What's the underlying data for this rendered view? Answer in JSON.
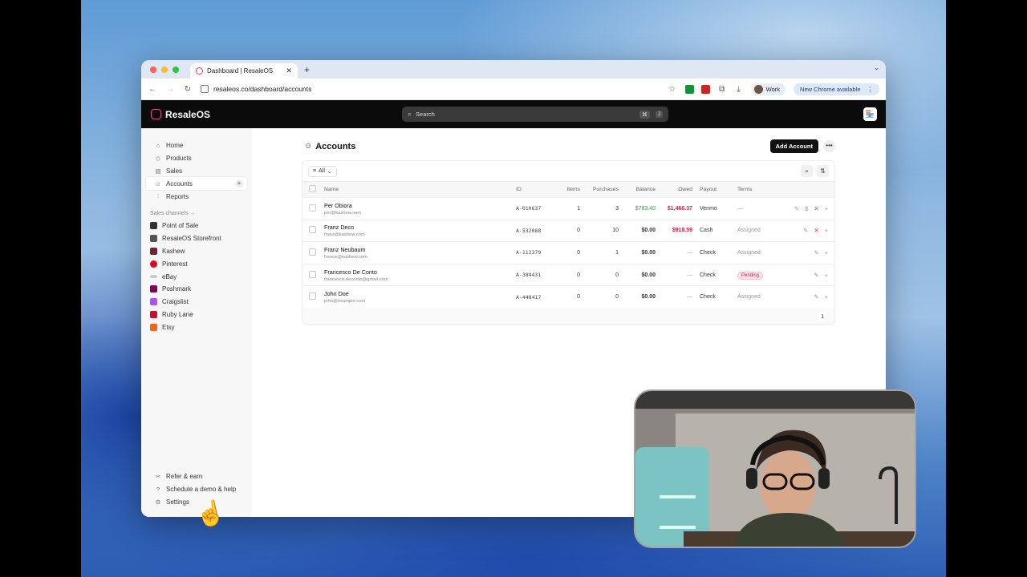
{
  "browser": {
    "tab_title": "Dashboard | ResaleOS",
    "tab_close": "✕",
    "new_tab": "+",
    "url": "resaleos.co/dashboard/accounts",
    "profile": "Work",
    "update_notice": "New Chrome available",
    "menu": "⋮"
  },
  "app": {
    "brand": "ResaleOS",
    "search_placeholder": "Search",
    "search_shortcut_1": "⌘",
    "search_shortcut_2": "J"
  },
  "sidebar": {
    "items": [
      {
        "label": "Home",
        "icon": "⌂"
      },
      {
        "label": "Products",
        "icon": "◇"
      },
      {
        "label": "Sales",
        "icon": "▤"
      },
      {
        "label": "Accounts",
        "icon": "☺"
      },
      {
        "label": "Reports",
        "icon": "⫶"
      }
    ],
    "add_symbol": "+",
    "channels_heading": "Sales channels →",
    "channels": [
      {
        "label": "Point of Sale",
        "color": "#333333"
      },
      {
        "label": "ResaleOS Storefront",
        "color": "#555555"
      },
      {
        "label": "Kashew",
        "color": "#7a1f2e"
      },
      {
        "label": "Pinterest",
        "color": "#e60023"
      },
      {
        "label": "eBay",
        "color": "#cccccc"
      },
      {
        "label": "Poshmark",
        "color": "#7f0353"
      },
      {
        "label": "Craigslist",
        "color": "#a855f7"
      },
      {
        "label": "Ruby Lane",
        "color": "#c8102e"
      },
      {
        "label": "Etsy",
        "color": "#f1641e"
      }
    ],
    "footer": [
      {
        "label": "Refer & earn",
        "icon": "✂"
      },
      {
        "label": "Schedule a demo & help",
        "icon": "?"
      },
      {
        "label": "Settings",
        "icon": "⚙"
      }
    ]
  },
  "page": {
    "title": "Accounts",
    "add_button": "Add Account",
    "more": "•••",
    "filter_label": "All",
    "columns": [
      "Name",
      "ID",
      "Items",
      "Purchases",
      "Balance",
      "Owed",
      "Payout",
      "Terms"
    ],
    "rows": [
      {
        "name": "Per Obiora",
        "email": "per@kashew.com",
        "id": "A-010637",
        "items": "1",
        "purchases": "3",
        "balance": "$783.40",
        "owed": "$1,466.37",
        "payout": "Venmo",
        "terms": "—",
        "actions": [
          "✎",
          "$",
          "✕",
          "+"
        ]
      },
      {
        "name": "Franz Deco",
        "email": "franz@kashew.com",
        "id": "A-532088",
        "items": "0",
        "purchases": "10",
        "balance": "$0.00",
        "owed": "$918.59",
        "payout": "Cash",
        "terms": "Assigned",
        "actions": [
          "✎",
          "✕",
          "+"
        ]
      },
      {
        "name": "Franz Neubaum",
        "email": "france@kashew.com",
        "id": "A-112379",
        "items": "0",
        "purchases": "1",
        "balance": "$0.00",
        "owed": "—",
        "payout": "Check",
        "terms": "Assigned",
        "actions": [
          "✎",
          "+"
        ]
      },
      {
        "name": "Francesco De Conto",
        "email": "francesco.deconto@gmail.com",
        "id": "A-384431",
        "items": "0",
        "purchases": "0",
        "balance": "$0.00",
        "owed": "—",
        "payout": "Check",
        "terms": "Pending",
        "actions": [
          "✎",
          "+"
        ]
      },
      {
        "name": "John Doe",
        "email": "john@example.com",
        "id": "A-448417",
        "items": "0",
        "purchases": "0",
        "balance": "$0.00",
        "owed": "—",
        "payout": "Check",
        "terms": "Assigned",
        "actions": [
          "✎",
          "+"
        ]
      }
    ],
    "page_number": "1"
  },
  "colors": {
    "accent": "#e24b8a",
    "balance_positive": "#2e9e4f",
    "owed": "#c62846"
  }
}
